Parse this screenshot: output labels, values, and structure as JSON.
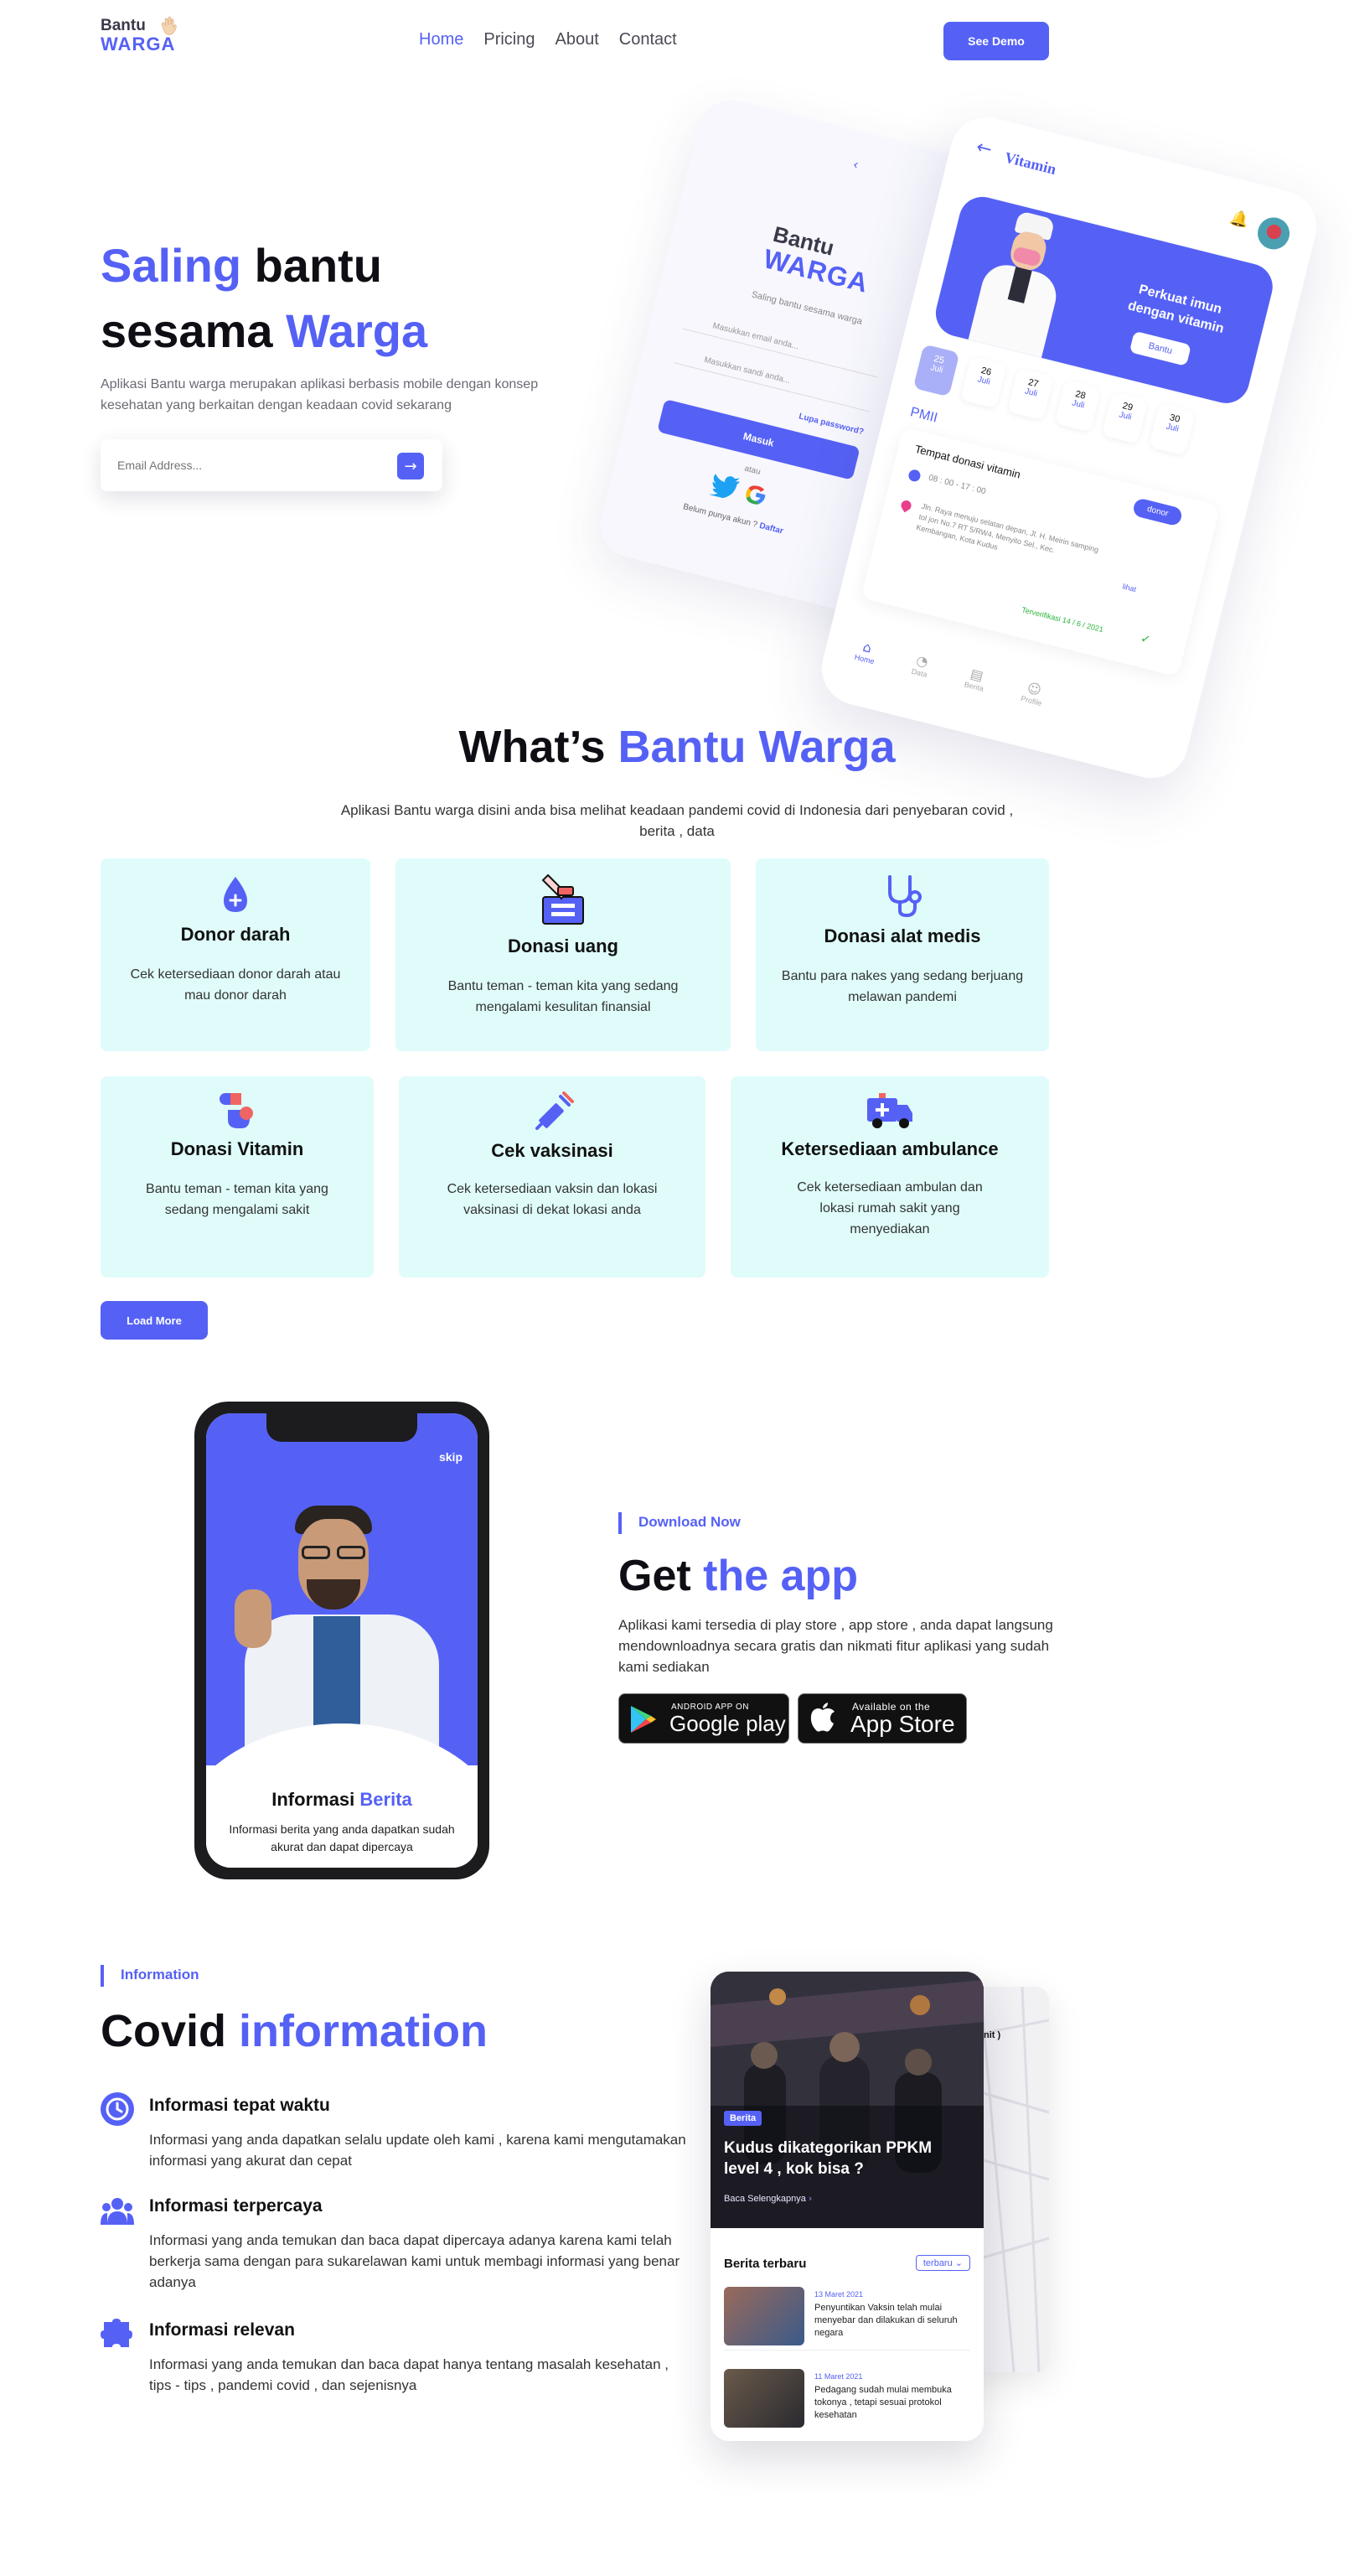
{
  "nav": {
    "logo_top": "Bantu",
    "logo_bottom": "WARGA",
    "links": [
      "Home",
      "Pricing",
      "About",
      "Contact"
    ],
    "cta": "See Demo"
  },
  "hero": {
    "title_a": "Saling",
    "title_b": " bantu",
    "title_c": "sesama ",
    "title_d": "Warga",
    "description": "Aplikasi Bantu warga merupakan aplikasi berbasis mobile dengan konsep kesehatan yang berkaitan dengan keadaan covid sekarang",
    "email_placeholder": "Email Address...",
    "login": {
      "brand_top": "Bantu",
      "brand_bottom": "WARGA",
      "tagline": "Saling bantu sesama warga",
      "email_placeholder": "Masukkan email anda...",
      "password_placeholder": "Masukkan sandi anda...",
      "forgot": "Lupa password?",
      "button": "Masuk",
      "or": "atau",
      "register_prompt": "Belum punya akun ?",
      "register_link": "Daftar"
    },
    "vitamin": {
      "title": "Vitamin",
      "banner": "Perkuat imun dengan vitamin",
      "banner_button": "Bantu",
      "dates": [
        {
          "day": "25",
          "month": "Juli"
        },
        {
          "day": "26",
          "month": "Juli"
        },
        {
          "day": "27",
          "month": "Juli"
        },
        {
          "day": "28",
          "month": "Juli"
        },
        {
          "day": "29",
          "month": "Juli"
        },
        {
          "day": "30",
          "month": "Juli"
        }
      ],
      "org": "PMII",
      "event_title": "Tempat donasi vitamin",
      "event_button": "donor",
      "event_time": "08 : 00 - 17 : 00",
      "event_address": "Jln. Raya menuju selatan depan, Jl. H. Meirin samping tol jon No.7 RT 5/RW4, Menyito Sel., Kec. Kembangan, Kota Kudus",
      "event_link": "lihat",
      "verified": "Terverifikasi 14 / 6 / 2021",
      "tabs": [
        "Home",
        "Data",
        "Berita",
        "Profile"
      ]
    }
  },
  "whats": {
    "title_a": "What’s ",
    "title_b": "Bantu Warga",
    "description": "Aplikasi Bantu warga disini anda bisa melihat keadaan pandemi covid di Indonesia dari penyebaran covid , berita , data",
    "cards": [
      {
        "title": "Donor darah",
        "desc": "Cek ketersediaan donor darah atau mau donor darah"
      },
      {
        "title": "Donasi uang",
        "desc": "Bantu teman - teman kita yang sedang mengalami kesulitan finansial"
      },
      {
        "title": "Donasi alat medis",
        "desc": "Bantu para nakes yang sedang berjuang melawan pandemi"
      },
      {
        "title": "Donasi Vitamin",
        "desc": "Bantu teman - teman kita yang sedang mengalami sakit"
      },
      {
        "title": "Cek vaksinasi",
        "desc": "Cek ketersediaan vaksin dan lokasi vaksinasi di dekat lokasi anda"
      },
      {
        "title": "Ketersediaan ambulance",
        "desc": "Cek ketersediaan ambulan dan lokasi rumah sakit yang menyediakan"
      }
    ],
    "load_more": "Load More"
  },
  "app": {
    "skip": "skip",
    "onboarding_title_a": "Informasi ",
    "onboarding_title_b": "Berita",
    "onboarding_desc": "Informasi berita yang anda dapatkan sudah akurat dan dapat dipercaya",
    "label": "Download Now",
    "title_a": "Get ",
    "title_b": "the app",
    "description": "Aplikasi kami tersedia di play store , app store , anda dapat langsung mendownloadnya secara gratis dan nikmati fitur aplikasi yang sudah kami sediakan",
    "google_small": "ANDROID APP ON",
    "google_big": "Google play",
    "apple_small": "Available on the",
    "apple_big": "App Store"
  },
  "covid": {
    "label": "Information",
    "title_a": "Covid ",
    "title_b": "information",
    "features": [
      {
        "title": "Informasi tepat waktu",
        "desc": "Informasi yang anda dapatkan selalu update oleh kami , karena kami mengutamakan informasi yang akurat dan cepat"
      },
      {
        "title": "Informasi terpercaya",
        "desc": "Informasi yang anda temukan dan baca dapat dipercaya adanya karena kami telah berkerja sama dengan para sukarelawan kami untuk membagi informasi yang benar adanya"
      },
      {
        "title": "Informasi relevan",
        "desc": "Informasi yang anda temukan dan baca dapat hanya tentang masalah kesehatan , tips - tips , pandemi covid , dan sejenisnya"
      }
    ],
    "news": {
      "tag": "Berita",
      "headline": "Kudus dikategorikan PPKM level 4 , kok bisa ?",
      "read_more": "Baca Selengkapnya",
      "latest": "Berita terbaru",
      "sort": "terbaru",
      "items": [
        {
          "date": "13 Maret 2021",
          "text": "Penyuntikan Vaksin telah mulai menyebar dan dilakukan di seluruh negara"
        },
        {
          "date": "11 Maret 2021",
          "text": "Pedagang sudah mulai membuka tokonya , tetapi sesuai protokol kesehatan"
        }
      ],
      "map_label": "nit )"
    }
  },
  "colors": {
    "accent": "#5561F5",
    "card": "#DFFCFA",
    "text": "#0e0e14"
  }
}
